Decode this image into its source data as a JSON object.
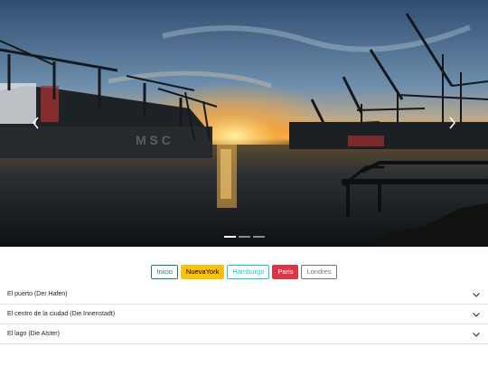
{
  "carousel": {
    "image_alt": "Hamburg harbour at sunset with container cranes",
    "indicator_count": 3,
    "active_index": 0,
    "prev_icon": "chevron-left-icon",
    "next_icon": "chevron-right-icon"
  },
  "buttons": [
    {
      "label": "Inicio",
      "style": "outline-success"
    },
    {
      "label": "NuevaYork",
      "style": "warning"
    },
    {
      "label": "Hamburgo",
      "style": "outline-info"
    },
    {
      "label": "Paris",
      "style": "danger"
    },
    {
      "label": "Londres",
      "style": "outline-secondary"
    }
  ],
  "accordion": [
    {
      "title": "El puerto (Der Hafen)",
      "icon": "chevron-down-icon"
    },
    {
      "title": "El centro de la ciudad (Die Innenstadt)",
      "icon": "chevron-down-icon"
    },
    {
      "title": "El lago (Die Alster)",
      "icon": "chevron-down-icon"
    }
  ],
  "colors": {
    "success": "#198754",
    "warning": "#ffc107",
    "info": "#0dcaf0",
    "danger": "#dc3545",
    "secondary": "#6c757d"
  }
}
